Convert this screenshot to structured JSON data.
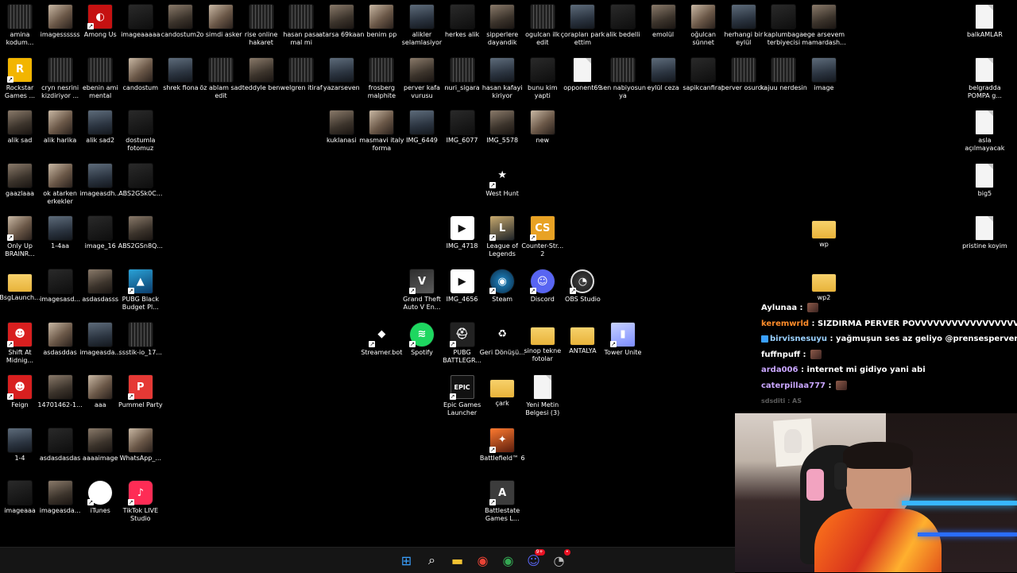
{
  "desktop": {
    "icons": [
      {
        "label": "amina kodum...",
        "icon": "video-file-icon"
      },
      {
        "label": "imagessssss",
        "icon": "image-file-icon"
      },
      {
        "label": "Among Us",
        "icon": "among-us-icon"
      },
      {
        "label": "imageaaaaa",
        "icon": "image-file-icon"
      },
      {
        "label": "candostum2",
        "icon": "image-file-icon"
      },
      {
        "label": "o simdi asker",
        "icon": "image-file-icon"
      },
      {
        "label": "rise online hakaret",
        "icon": "video-file-icon"
      },
      {
        "label": "hasan pasa mal mi",
        "icon": "video-file-icon"
      },
      {
        "label": "atarsa 69kaan",
        "icon": "image-file-icon"
      },
      {
        "label": "benim pp",
        "icon": "image-file-icon"
      },
      {
        "label": "alikler selamlasiyor",
        "icon": "image-file-icon"
      },
      {
        "label": "herkes alik",
        "icon": "image-file-icon"
      },
      {
        "label": "sipperlere dayandik",
        "icon": "image-file-icon"
      },
      {
        "label": "ogulcan ilk edit",
        "icon": "video-file-icon"
      },
      {
        "label": "çorapları park ettim",
        "icon": "image-file-icon"
      },
      {
        "label": "alik bedelli",
        "icon": "image-file-icon"
      },
      {
        "label": "emolül",
        "icon": "image-file-icon"
      },
      {
        "label": "oğulcan sünnet",
        "icon": "image-file-icon"
      },
      {
        "label": "herhangi bir eylül",
        "icon": "image-file-icon"
      },
      {
        "label": "kaplumbaga terbiyecisi",
        "icon": "image-file-icon"
      },
      {
        "label": "ege arsevem mamardash...",
        "icon": "image-file-icon"
      },
      {
        "label": "balkAMLAR",
        "icon": "document-icon"
      },
      {
        "label": "Rockstar Games ...",
        "icon": "rockstar-icon"
      },
      {
        "label": "cryn nesrini kizdiriyor ...",
        "icon": "video-file-icon"
      },
      {
        "label": "ebenin ami mental",
        "icon": "video-file-icon"
      },
      {
        "label": "candostum",
        "icon": "image-file-icon"
      },
      {
        "label": "shrek fiona",
        "icon": "image-file-icon"
      },
      {
        "label": "öz ablam sad edit",
        "icon": "video-file-icon"
      },
      {
        "label": "teddyle ben",
        "icon": "image-file-icon"
      },
      {
        "label": "welgren itiraf",
        "icon": "video-file-icon"
      },
      {
        "label": "yazarseven",
        "icon": "image-file-icon"
      },
      {
        "label": "frosberg malphite",
        "icon": "video-file-icon"
      },
      {
        "label": "perver kafa vurusu",
        "icon": "image-file-icon"
      },
      {
        "label": "nuri_sigara",
        "icon": "video-file-icon"
      },
      {
        "label": "hasan kafayi kiriyor",
        "icon": "image-file-icon"
      },
      {
        "label": "bunu kim yapti",
        "icon": "image-file-icon"
      },
      {
        "label": "opponent69",
        "icon": "document-icon"
      },
      {
        "label": "sen nabiyosun ya",
        "icon": "video-file-icon"
      },
      {
        "label": "eylül ceza",
        "icon": "image-file-icon"
      },
      {
        "label": "sapikcanfirat",
        "icon": "image-file-icon"
      },
      {
        "label": "perver osurdu",
        "icon": "video-file-icon"
      },
      {
        "label": "kajuu nerdesin",
        "icon": "video-file-icon"
      },
      {
        "label": "image",
        "icon": "image-file-icon"
      },
      {
        "label": "belgradda POMPA g...",
        "icon": "document-icon"
      },
      {
        "label": "alik sad",
        "icon": "image-file-icon"
      },
      {
        "label": "alik harika",
        "icon": "image-file-icon"
      },
      {
        "label": "alik sad2",
        "icon": "image-file-icon"
      },
      {
        "label": "dostumla fotomuz",
        "icon": "image-file-icon"
      },
      {
        "label": "kuklanasi",
        "icon": "image-file-icon"
      },
      {
        "label": "masmavi italy forma",
        "icon": "image-file-icon"
      },
      {
        "label": "IMG_6449",
        "icon": "image-file-icon"
      },
      {
        "label": "IMG_6077",
        "icon": "image-file-icon"
      },
      {
        "label": "IMG_5578",
        "icon": "image-file-icon"
      },
      {
        "label": "new",
        "icon": "image-file-icon"
      },
      {
        "label": "asla açılmayacak",
        "icon": "document-icon"
      },
      {
        "label": "West Hunt",
        "icon": "west-hunt-icon"
      },
      {
        "label": "gaazlaaa",
        "icon": "image-file-icon"
      },
      {
        "label": "ok atarken erkekler",
        "icon": "image-file-icon"
      },
      {
        "label": "imageasdh...",
        "icon": "image-file-icon"
      },
      {
        "label": "ABS2GSk0C...",
        "icon": "image-file-icon"
      },
      {
        "label": "big5",
        "icon": "document-icon"
      },
      {
        "label": "Only Up BRAINR...",
        "icon": "only-up-icon"
      },
      {
        "label": "1-4aa",
        "icon": "image-file-icon"
      },
      {
        "label": "image_16",
        "icon": "image-file-icon"
      },
      {
        "label": "ABS2GSn8Q...",
        "icon": "image-file-icon"
      },
      {
        "label": "IMG_4718",
        "icon": "video-player-icon"
      },
      {
        "label": "League of Legends",
        "icon": "league-of-legends-icon"
      },
      {
        "label": "Counter-Str... 2",
        "icon": "counter-strike-icon"
      },
      {
        "label": "wp",
        "icon": "folder-icon"
      },
      {
        "label": "pristine koyim",
        "icon": "document-icon"
      },
      {
        "label": "BsgLaunch...",
        "icon": "folder-icon"
      },
      {
        "label": "imagesasd...",
        "icon": "image-file-icon"
      },
      {
        "label": "asdasdasss",
        "icon": "image-file-icon"
      },
      {
        "label": "PUBG Black Budget Pl...",
        "icon": "pubg-black-budget-icon"
      },
      {
        "label": "Grand Theft Auto V En...",
        "icon": "gta-v-icon"
      },
      {
        "label": "IMG_4656",
        "icon": "video-player-icon"
      },
      {
        "label": "Steam",
        "icon": "steam-icon"
      },
      {
        "label": "Discord",
        "icon": "discord-icon"
      },
      {
        "label": "OBS Studio",
        "icon": "obs-studio-icon"
      },
      {
        "label": "wp2",
        "icon": "folder-icon"
      },
      {
        "label": "Shift At Midnig...",
        "icon": "shift-at-midnight-icon"
      },
      {
        "label": "asdasddas",
        "icon": "image-file-icon"
      },
      {
        "label": "imageasda...",
        "icon": "image-file-icon"
      },
      {
        "label": "ssstik-io_17...",
        "icon": "video-file-icon"
      },
      {
        "label": "Streamer.bot",
        "icon": "streamer-bot-icon"
      },
      {
        "label": "Spotify",
        "icon": "spotify-icon"
      },
      {
        "label": "PUBG BATTLEGR...",
        "icon": "pubg-icon"
      },
      {
        "label": "Geri Dönüşü...",
        "icon": "recycle-bin-icon"
      },
      {
        "label": "sinop tekne fotolar",
        "icon": "folder-icon"
      },
      {
        "label": "ANTALYA",
        "icon": "folder-icon"
      },
      {
        "label": "Tower Unite",
        "icon": "tower-unite-icon"
      },
      {
        "label": "Feign",
        "icon": "feign-icon"
      },
      {
        "label": "14701462-1...",
        "icon": "image-file-icon"
      },
      {
        "label": "aaa",
        "icon": "image-file-icon"
      },
      {
        "label": "Pummel Party",
        "icon": "pummel-party-icon"
      },
      {
        "label": "Epic Games Launcher",
        "icon": "epic-games-icon"
      },
      {
        "label": "çark",
        "icon": "folder-icon"
      },
      {
        "label": "Yeni Metin Belgesi (3)",
        "icon": "document-icon"
      },
      {
        "label": "1-4",
        "icon": "image-file-icon"
      },
      {
        "label": "asdasdasdas",
        "icon": "image-file-icon"
      },
      {
        "label": "aaaaimage",
        "icon": "image-file-icon"
      },
      {
        "label": "WhatsApp_...",
        "icon": "image-file-icon"
      },
      {
        "label": "Battlefield™ 6",
        "icon": "battlefield-icon"
      },
      {
        "label": "imageaaa",
        "icon": "image-file-icon"
      },
      {
        "label": "imageasda...",
        "icon": "image-file-icon"
      },
      {
        "label": "iTunes",
        "icon": "itunes-icon"
      },
      {
        "label": "TikTok LIVE Studio",
        "icon": "tiktok-live-icon"
      },
      {
        "label": "Battlestate Games L...",
        "icon": "battlestate-icon"
      }
    ]
  },
  "chat": {
    "messages": [
      {
        "user": "Aylunaa",
        "user_color": "#ffffff",
        "text": "",
        "emote": true
      },
      {
        "user": "keremwrld",
        "user_color": "#ff8c2a",
        "text": "SIZDIRMA PERVER POVVVVVVVVVVVVVVVVVV",
        "emote": false
      },
      {
        "user": "birvisnesuyu",
        "user_color": "#9ad1ff",
        "text": "yağmuşun ses az geliyo @prensesperver",
        "emote": false,
        "badges": true
      },
      {
        "user": "fuffnpuff",
        "user_color": "#ffffff",
        "text": "",
        "emote": true
      },
      {
        "user": "arda006",
        "user_color": "#c9a6ff",
        "text": "internet mi gidiyo yani abi",
        "emote": false
      },
      {
        "user": "caterpillaa777",
        "user_color": "#c9a6ff",
        "text": "",
        "emote": true
      }
    ],
    "faded": "sdsditi : AS"
  },
  "taskbar": {
    "items": [
      {
        "name": "windows-start-icon",
        "color": "#3aa0ff"
      },
      {
        "name": "search-icon",
        "color": "#ffffff"
      },
      {
        "name": "file-explorer-icon",
        "color": "#f2c232"
      },
      {
        "name": "chrome-icon",
        "color": "#ea4335"
      },
      {
        "name": "chrome-profile-icon",
        "color": "#34a853"
      },
      {
        "name": "discord-icon",
        "color": "#5865f2",
        "badge": "9+"
      },
      {
        "name": "obs-icon",
        "color": "#bbbbbb",
        "badge": "•"
      }
    ]
  },
  "colors": {
    "desktop_bg": "#000000",
    "taskbar_bg": "#151515"
  }
}
